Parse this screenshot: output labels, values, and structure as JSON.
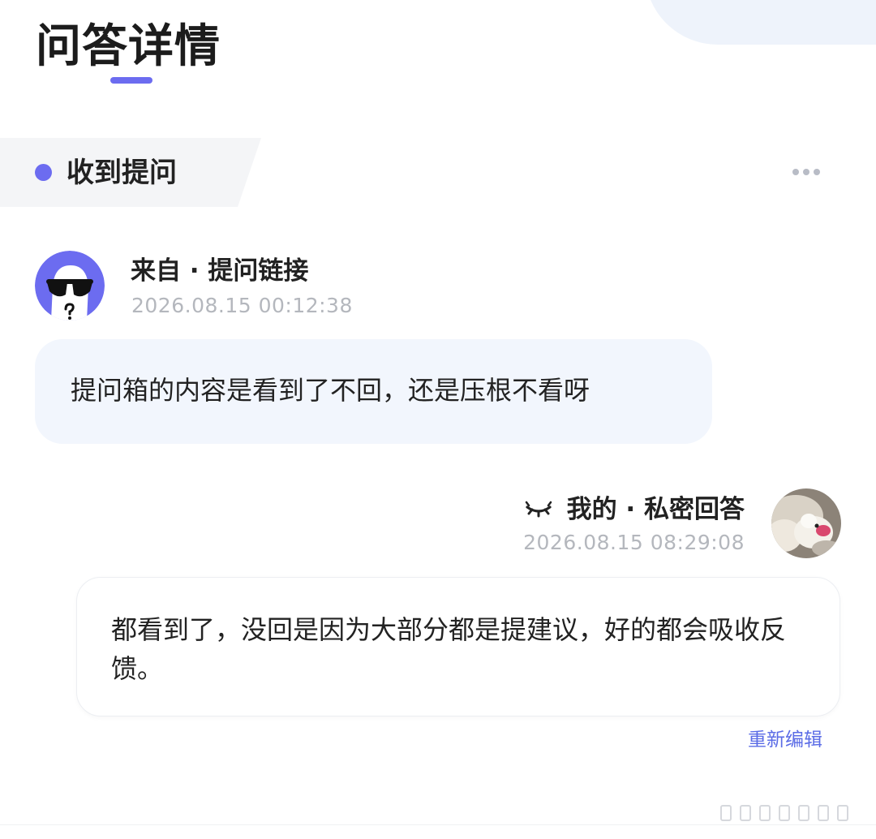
{
  "page": {
    "title": "问答详情"
  },
  "section": {
    "label": "收到提问",
    "more_icon": "more-dots-icon"
  },
  "question": {
    "source": "来自 · 提问链接",
    "time": "2026.08.15 00:12:38",
    "content": "提问箱的内容是看到了不回，还是压根不看呀"
  },
  "answer": {
    "label": "我的 · 私密回答",
    "privacy_icon": "closed-eye-icon",
    "time": "2026.08.15 08:29:08",
    "content": "都看到了，没回是因为大部分都是提建议，好的都会吸收反馈。",
    "edit_label": "重新编辑"
  },
  "colors": {
    "accent": "#6c6cf0",
    "link": "#5b6ce6",
    "question_bg": "#f2f6fd",
    "muted_text": "#b4b7bd"
  }
}
